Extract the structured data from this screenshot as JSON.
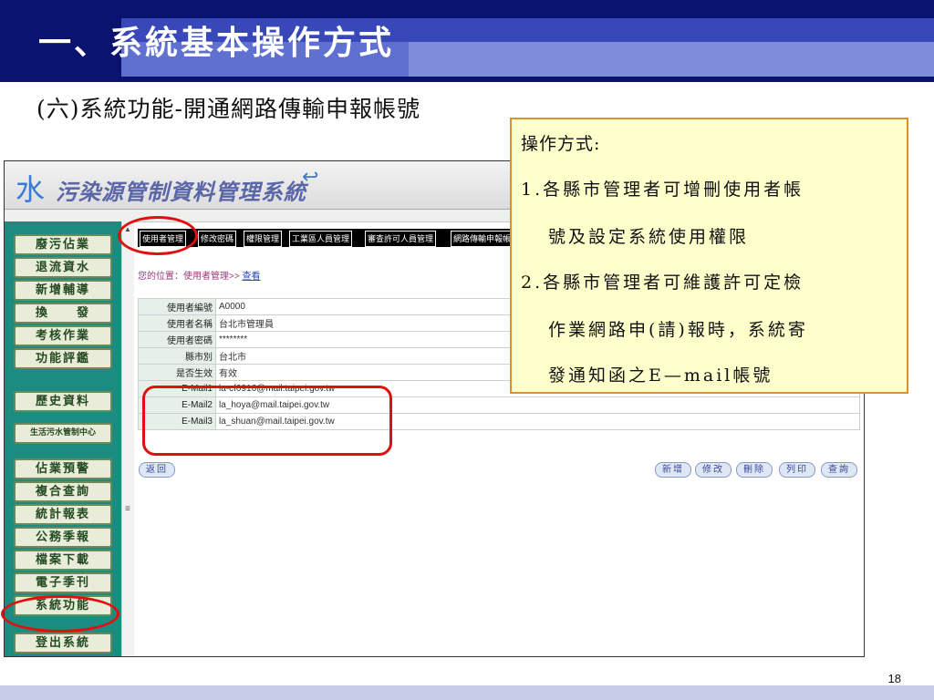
{
  "slide": {
    "title": "一、系統基本操作方式",
    "subtitle": "(六)系統功能-開通網路傳輸申報帳號",
    "page_number": "18"
  },
  "app": {
    "logo_glyph": "水",
    "logo_title": "污染源管制資料管理系統",
    "logo_arrow": "↩"
  },
  "sidebar": {
    "items": [
      "廢污佔業",
      "退流資水",
      "新增輔導",
      "換　　發",
      "考核作業",
      "功能評鑑",
      "歷史資料",
      "生活污水管制中心",
      "佔業預警",
      "複合查詢",
      "統計報表",
      "公務季報",
      "檔案下載",
      "電子季刊",
      "系統功能",
      "登出系統"
    ]
  },
  "menu": {
    "items": [
      "使用者管理",
      "修改密碼",
      "權限管理",
      "工業區人員管理",
      "審查許可人員管理",
      "網路傳輸申報帳號"
    ]
  },
  "breadcrumb": {
    "prefix": "您的位置：使用者管理>> ",
    "link": "查看"
  },
  "form": {
    "rows": [
      {
        "label": "使用者編號",
        "value": "A0000"
      },
      {
        "label": "使用者名稱",
        "value": "台北市管理員"
      },
      {
        "label": "使用者密碼",
        "value": "********"
      },
      {
        "label": "縣市別",
        "value": "台北市"
      },
      {
        "label": "是否生效",
        "value": "有效"
      },
      {
        "label": "E-Mail1",
        "value": "la-cf0916@mail.taipei.gov.tw"
      },
      {
        "label": "E-Mail2",
        "value": "la_hoya@mail.taipei.gov.tw"
      },
      {
        "label": "E-Mail3",
        "value": "la_shuan@mail.taipei.gov.tw"
      }
    ]
  },
  "buttons": {
    "back": "返回",
    "add": "新增",
    "edit": "修改",
    "delete": "刪除",
    "print": "列印",
    "query": "查詢"
  },
  "callout": {
    "title": "操作方式:",
    "item1_line1": "1.各縣市管理者可增刪使用者帳",
    "item1_line2": "號及設定系統使用權限",
    "item2_line1": "2.各縣市管理者可維護許可定檢",
    "item2_line2": "作業網路申(請)報時，系統寄",
    "item2_line3": "發通知函之E—mail帳號"
  },
  "colors": {
    "header_navy": "#0a1470",
    "sidebar_teal": "#1c8c80",
    "highlight_red": "#e01010",
    "callout_fill": "#ffffcc",
    "callout_border": "#e0902a"
  }
}
